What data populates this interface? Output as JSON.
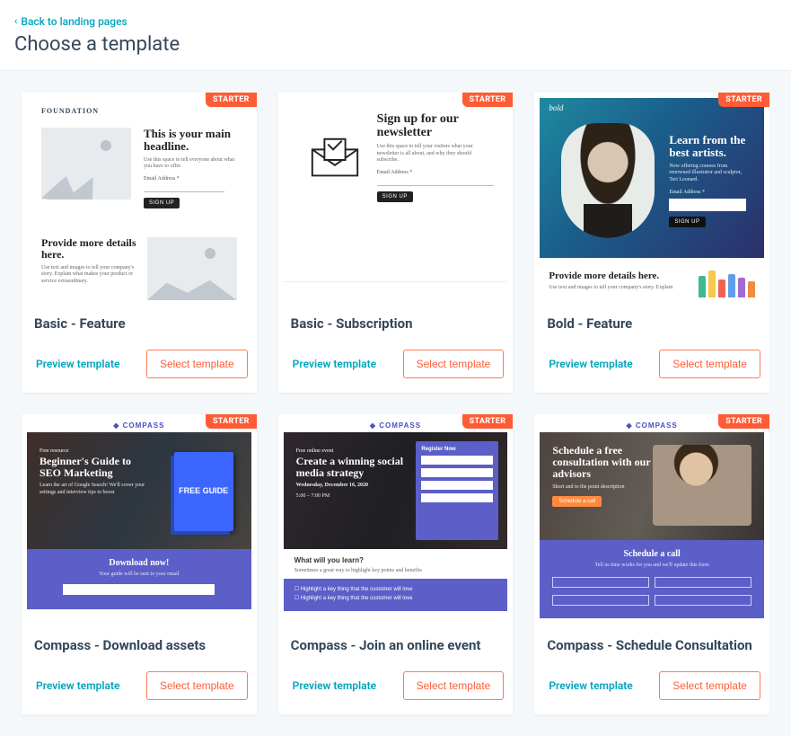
{
  "header": {
    "back_link": "Back to landing pages",
    "title": "Choose a template"
  },
  "labels": {
    "preview": "Preview template",
    "select": "Select template",
    "starter_badge": "STARTER"
  },
  "templates": [
    {
      "name": "Basic - Feature",
      "preview": {
        "brand": "FOUNDATION",
        "headline1": "This is your main headline.",
        "sub1": "Use this space to tell everyone about what you have to offer.",
        "email_label": "Email Address *",
        "signup_btn": "SIGN UP",
        "headline2": "Provide more details here.",
        "sub2": "Use text and images to tell your company's story. Explain what makes your product or service extraordinary."
      }
    },
    {
      "name": "Basic - Subscription",
      "preview": {
        "headline": "Sign up for our newsletter",
        "sub": "Use this space to tell your visitors what your newsletter is all about, and why they should subscribe.",
        "email_label": "Email Address *",
        "signup_btn": "SIGN UP"
      }
    },
    {
      "name": "Bold - Feature",
      "preview": {
        "brand": "bold",
        "headline": "Learn from the best artists.",
        "sub": "Now offering courses from renowned illustrator and sculptor, Teri Leonard.",
        "email_label": "Email Address *",
        "signup_btn": "SIGN UP",
        "headline2": "Provide more details here.",
        "sub2": "Use text and images to tell your company's story. Explain"
      }
    },
    {
      "name": "Compass - Download assets",
      "preview": {
        "brand": "COMPASS",
        "kicker": "Free resource",
        "headline": "Beginner's Guide to SEO Marketing",
        "sub": "Learn the art of Google Search! We'll cover your settings and interview tips to boost",
        "book_label": "FREE GUIDE",
        "strip_headline": "Download now!",
        "strip_sub": "Your guide will be sent to your email"
      }
    },
    {
      "name": "Compass - Join an online event",
      "preview": {
        "brand": "COMPASS",
        "kicker": "Free online event",
        "headline": "Create a winning social media strategy",
        "date_line": "Wednesday, December 16, 2020",
        "time_line": "5:00 – 7:00 PM",
        "form_title": "Register Now",
        "below_headline": "What will you learn?",
        "below_sub": "Sometimes a great way to highlight key points and benefits",
        "checkbox": "Highlight a key thing that the customer will love"
      }
    },
    {
      "name": "Compass - Schedule Consultation",
      "preview": {
        "brand": "COMPASS",
        "headline": "Schedule a free consultation with our advisors",
        "sub": "Short and to the point description",
        "cta": "Schedule a call",
        "strip_headline": "Schedule a call",
        "strip_sub": "Tell us time works for you and we'll update this form"
      }
    }
  ]
}
